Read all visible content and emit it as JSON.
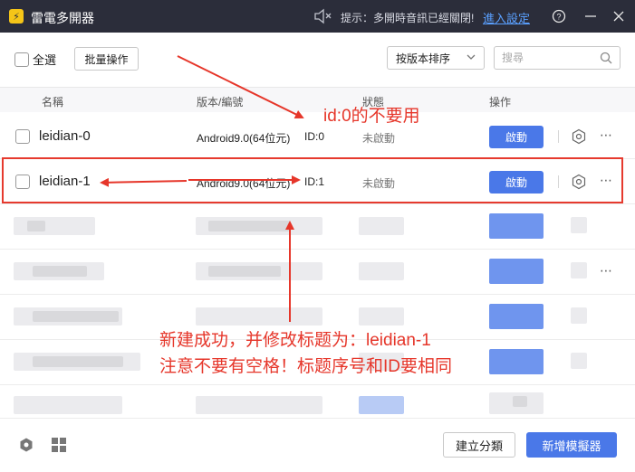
{
  "titlebar": {
    "title": "雷電多開器",
    "notice": "提示：多開時音訊已經關閉!",
    "notice_link": "進入設定",
    "mute_icon": "speaker-muted-icon",
    "help_icon": "question-circle-icon",
    "minimize_icon": "minus-icon",
    "close_icon": "close-icon"
  },
  "toolbar": {
    "select_all_label": "全選",
    "batch_label": "批量操作",
    "sort_label": "按版本排序",
    "search_placeholder": "搜尋"
  },
  "table": {
    "headers": {
      "name": "名稱",
      "version": "版本/編號",
      "status": "狀態",
      "actions": "操作"
    },
    "rows": [
      {
        "name": "leidian-0",
        "version": "Android9.0(64位元)",
        "id": "ID:0",
        "status": "未啟動",
        "action": "啟動"
      },
      {
        "name": "leidian-1",
        "version": "Android9.0(64位元)",
        "id": "ID:1",
        "status": "未啟動",
        "action": "啟動"
      }
    ]
  },
  "annotations": {
    "note1": "id:0的不要用",
    "note2": "新建成功，并修改标题为：leidian-1",
    "note3": "注意不要有空格！标题序号和ID要相同",
    "color": "#e6362a"
  },
  "footer": {
    "category_label": "建立分類",
    "new_label": "新增模擬器"
  },
  "colors": {
    "titlebar": "#2b2d3a",
    "primary": "#4a78e8",
    "link": "#5aa0ff"
  }
}
